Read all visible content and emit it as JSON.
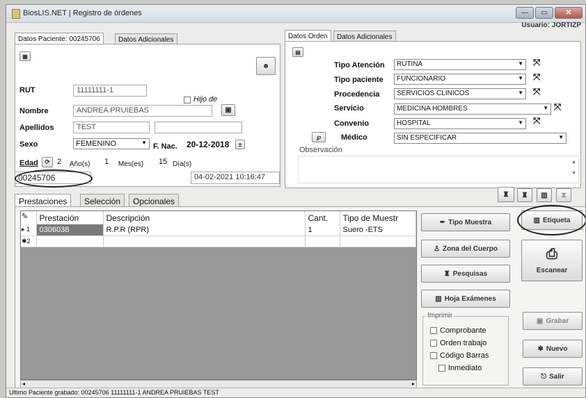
{
  "title": "BiosLIS.NET | Registro de órdenes",
  "user": "Usuario: JORTIZP",
  "window_buttons": {
    "min": "—",
    "max": "▭",
    "close": "✕"
  },
  "patient_tabs": [
    "Datos Paciente: 00245706",
    "Datos Adicionales"
  ],
  "order_tabs": [
    "Datos Orden",
    "Datos Adicionales"
  ],
  "patient": {
    "rut_label": "RUT",
    "rut": "11111111-1",
    "hijo_label": "Hijo de",
    "nombre_label": "Nombre",
    "nombre": "ANDREA PRUIEBAS",
    "apellidos_label": "Apellidos",
    "apellido1": "TEST",
    "apellido2": "",
    "sexo_label": "Sexo",
    "sexo": "FEMENINO",
    "fnac_label": "F. Nac.",
    "fnac": "20-12-2018",
    "edad_label": "Edad",
    "anos": "2",
    "anos_label": "Año(s)",
    "meses": "1",
    "meses_label": "Mes(es)",
    "dias": "15",
    "dias_label": "Día(s)",
    "numero": "00245706",
    "fecha": "04-02-2021 10:16:47"
  },
  "order": {
    "tipo_atencion_label": "Tipo Atención",
    "tipo_atencion": "RUTINA",
    "tipo_paciente_label": "Tipo paciente",
    "tipo_paciente": "FUNCIONARIO",
    "procedencia_label": "Procedencia",
    "procedencia": "SERVICIOS CLINICOS",
    "servicio_label": "Servicio",
    "servicio": "MEDICINA HOMBRES",
    "convenio_label": "Convenio",
    "convenio": "HOSPITAL",
    "medico_label": "Médico",
    "medico": "SIN ESPECIFICAR",
    "observacion_label": "Observación"
  },
  "bottom_tabs": [
    "Prestaciones",
    "Selección",
    "Opcionales"
  ],
  "grid": {
    "columns": [
      "Prestación",
      "Descripción",
      "Cant.",
      "Tipo de Muestr"
    ],
    "rows": [
      {
        "marker": "▸ 1",
        "prestacion": "0306038",
        "descripcion": "R.P.R (RPR)",
        "cant": "1",
        "tipo": "Suero -ETS"
      },
      {
        "marker": "✱2",
        "prestacion": "",
        "descripcion": "",
        "cant": "",
        "tipo": ""
      }
    ]
  },
  "actions": {
    "tipo_muestra": "Tipo Muestra",
    "zona_cuerpo": "Zona del Cuerpo",
    "pesquisas": "Pesquisas",
    "hoja_examenes": "Hoja Exámenes",
    "etiqueta": "Etiqueta",
    "escanear": "Escanear",
    "grabar": "Grabar",
    "nuevo": "Nuevo",
    "salir": "Salir"
  },
  "imprimir": {
    "label": "Imprimir",
    "comprobante": "Comprobante",
    "orden_trabajo": "Orden trabajo",
    "codigo_barras": "Código Barras",
    "inmediato": "Inmediato"
  },
  "status": "Ultimo Paciente grabado: 00245706 11111111-1 ANDREA PRUIEBAS TEST"
}
